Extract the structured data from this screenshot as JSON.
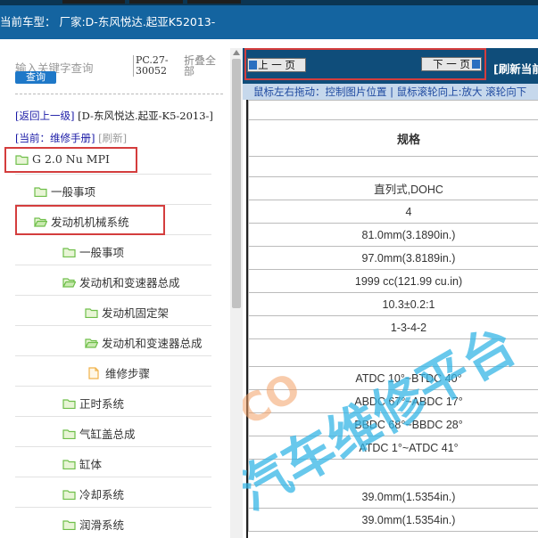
{
  "vehicle_bar": {
    "text": "当前车型：  厂家:D-东风悦达.起亚K52013-"
  },
  "left_panel": {
    "search_placeholder": "输入关键字查询",
    "search_button": "查询",
    "pc_code": "PC.27-30052",
    "fold_all": "折叠全部",
    "back_link": "[返回上一级]",
    "back_path": "[D-东风悦达.起亚-K5-2013-]",
    "current_label": "[当前：维修手册]",
    "refresh_label": "[刷新]",
    "tree": [
      {
        "label": "G 2.0 Nu MPI",
        "type": "folder",
        "level": 0
      },
      {
        "label": "一般事项",
        "type": "folder",
        "level": 1
      },
      {
        "label": "发动机机械系统",
        "type": "folder",
        "level": 1
      },
      {
        "label": "一般事项",
        "type": "folder",
        "level": 2
      },
      {
        "label": "发动机和变速器总成",
        "type": "folder",
        "level": 2
      },
      {
        "label": "发动机固定架",
        "type": "folder",
        "level": 3
      },
      {
        "label": "发动机和变速器总成",
        "type": "folder",
        "level": 3
      },
      {
        "label": "维修步骤",
        "type": "page",
        "level": 3
      },
      {
        "label": "正时系统",
        "type": "folder",
        "level": 2
      },
      {
        "label": "气缸盖总成",
        "type": "folder",
        "level": 2
      },
      {
        "label": "缸体",
        "type": "folder",
        "level": 2
      },
      {
        "label": "冷却系统",
        "type": "folder",
        "level": 2
      },
      {
        "label": "润滑系统",
        "type": "folder",
        "level": 2
      }
    ]
  },
  "right_panel": {
    "prev_button": "上 一 页",
    "next_button": "下 一 页",
    "refresh_current": "[刷新当前",
    "hint": "鼠标左右拖动：控制图片位置 | 鼠标滚轮向上:放大  滚轮向下",
    "table_header": "规格",
    "table_rows": [
      "",
      "直列式,DOHC",
      "4",
      "81.0mm(3.1890in.)",
      "97.0mm(3.8189in.)",
      "1999 cc(121.99 cu.in)",
      "10.3±0.2:1",
      "1-3-4-2",
      "",
      "ATDC 10°~BTDC 40°",
      "ABDC 67°~ABDC 17°",
      "BBDC 68°~BBDC 28°",
      "ATDC 1°~ATDC 41°",
      "",
      "39.0mm(1.5354in.)",
      "39.0mm(1.5354in.)"
    ],
    "watermark": "汽车维修平台",
    "watermark_prefix": "CO"
  },
  "colors": {
    "vehicle_bar_bg": "#1464a0",
    "nav_bg": "#0f4d7a",
    "hint_bg": "#c6d8ec",
    "highlight_red": "#d43d3d",
    "folder_green": "#6fbf4a",
    "watermark_cyan": "#35b6e6"
  }
}
